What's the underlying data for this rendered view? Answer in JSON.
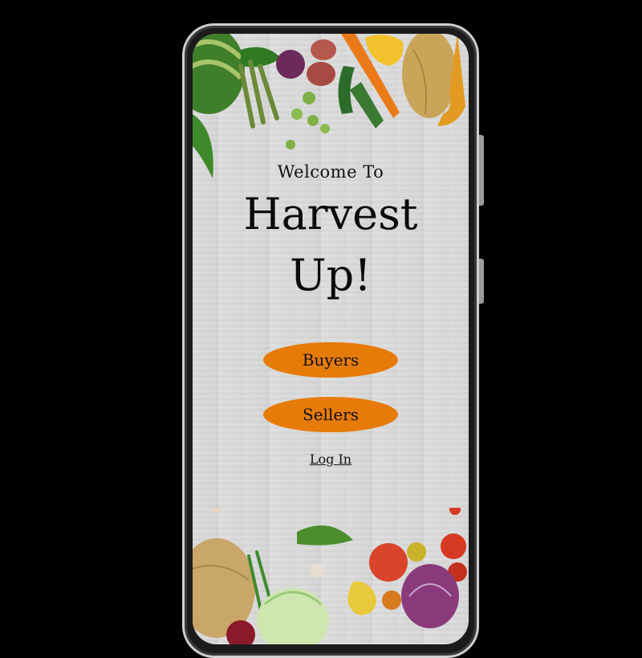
{
  "welcome": {
    "small_title": "Welcome To",
    "title_line1": "Harvest",
    "title_line2": "Up!"
  },
  "buttons": {
    "buyers_label": "Buyers",
    "sellers_label": "Sellers"
  },
  "links": {
    "login_label": "Log In"
  },
  "colors": {
    "accent": "#e77b08",
    "background": "#000000"
  }
}
